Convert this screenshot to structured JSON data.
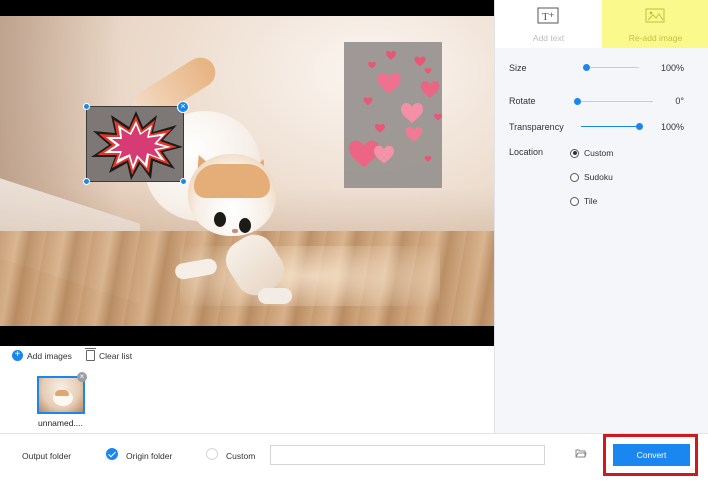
{
  "right_panel": {
    "tabs": [
      {
        "label": "Add text",
        "icon": "add-text-icon",
        "active": false
      },
      {
        "label": "Re-add image",
        "icon": "image-icon",
        "active": true,
        "highlight_color": "#fafa8c"
      }
    ],
    "controls": {
      "size": {
        "label": "Size",
        "value": "100%",
        "level": 0.05
      },
      "rotate": {
        "label": "Rotate",
        "value": "0°",
        "level": 0.0
      },
      "transparency": {
        "label": "Transparency",
        "value": "100%",
        "level": 1.0
      }
    },
    "location": {
      "label": "Location",
      "options": [
        {
          "label": "Custom",
          "selected": true
        },
        {
          "label": "Sudoku",
          "selected": false
        },
        {
          "label": "Tile",
          "selected": false
        }
      ]
    }
  },
  "image_list": {
    "add_label": "Add images",
    "clear_label": "Clear list",
    "items": [
      {
        "name": "unnamed...."
      }
    ]
  },
  "bottom_bar": {
    "output_folder_label": "Output folder",
    "origin_folder_label": "Origin folder",
    "origin_selected": true,
    "custom_label": "Custom",
    "custom_path": "",
    "convert_label": "Convert"
  },
  "colors": {
    "accent": "#1a86f0",
    "highlight_box": "#d0181d",
    "tab_highlight": "#fafa8c"
  }
}
